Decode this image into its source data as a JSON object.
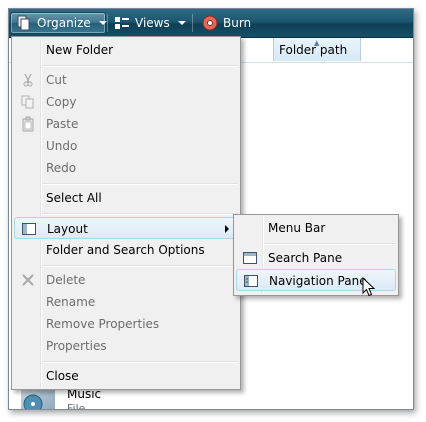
{
  "toolbar": {
    "organize_label": "Organize",
    "organize_icon": "organize-icon",
    "views_label": "Views",
    "views_icon": "views-icon",
    "burn_label": "Burn",
    "burn_icon": "burn-disc-icon"
  },
  "list": {
    "column_header": "Folder path",
    "items": [
      {
        "name": "Music",
        "type": "File Folder",
        "icon": "music-folder-icon"
      }
    ]
  },
  "organize_menu": {
    "new_folder": "New Folder",
    "cut": "Cut",
    "copy": "Copy",
    "paste": "Paste",
    "undo": "Undo",
    "redo": "Redo",
    "select_all": "Select All",
    "layout": "Layout",
    "folder_search_options": "Folder and Search Options",
    "delete": "Delete",
    "rename": "Rename",
    "remove_properties": "Remove Properties",
    "properties": "Properties",
    "close": "Close"
  },
  "layout_submenu": {
    "menu_bar": "Menu Bar",
    "search_pane": "Search Pane",
    "navigation_pane": "Navigation Pane"
  },
  "colors": {
    "toolbar": "#1c5670",
    "highlight_border": "#a8d8eb",
    "disabled_text": "#6d6d6d"
  }
}
